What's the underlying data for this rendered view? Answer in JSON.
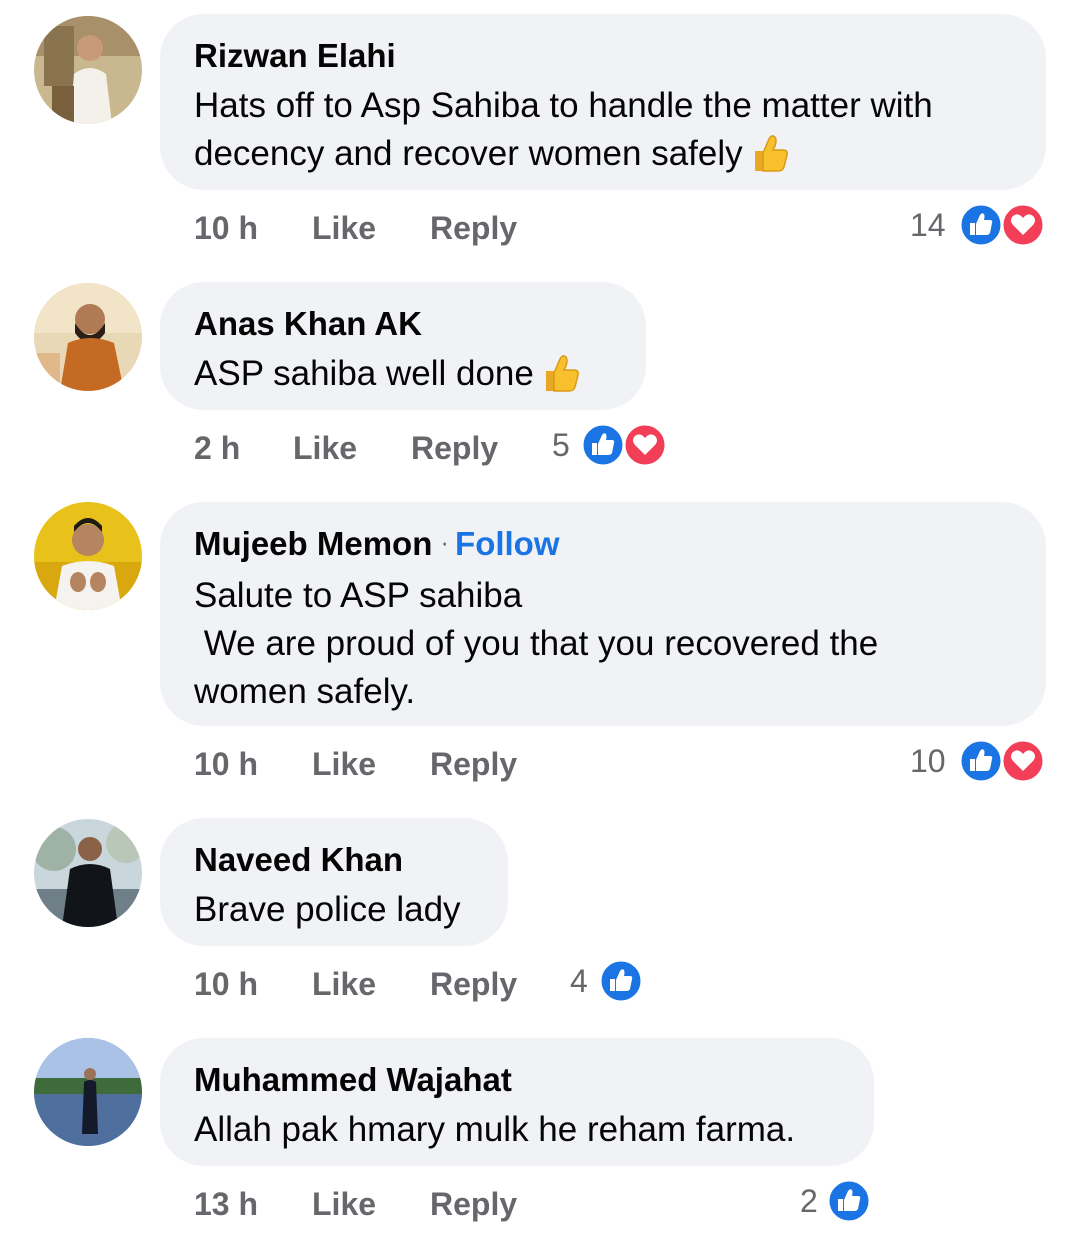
{
  "comments": [
    {
      "author": "Rizwan Elahi",
      "text": "Hats off to Asp Sahiba to handle the matter with\ndecency and recover women safely",
      "emoji": "thumbs-up-emoji",
      "time": "10 h",
      "like_label": "Like",
      "reply_label": "Reply",
      "reaction_count": "14",
      "reactions": [
        "like",
        "love"
      ]
    },
    {
      "author": "Anas Khan AK",
      "text": "ASP sahiba well done",
      "emoji": "thumbs-up-emoji",
      "time": "2 h",
      "like_label": "Like",
      "reply_label": "Reply",
      "reaction_count": "5",
      "reactions": [
        "like",
        "love"
      ]
    },
    {
      "author": "Mujeeb Memon",
      "separator": "·",
      "follow_label": "Follow",
      "text": "Salute to ASP sahiba\n We are proud of you that you recovered the\nwomen safely.",
      "time": "10 h",
      "like_label": "Like",
      "reply_label": "Reply",
      "reaction_count": "10",
      "reactions": [
        "like",
        "love"
      ]
    },
    {
      "author": "Naveed Khan",
      "text": "Brave police lady",
      "time": "10 h",
      "like_label": "Like",
      "reply_label": "Reply",
      "reaction_count": "4",
      "reactions": [
        "like"
      ]
    },
    {
      "author": "Muhammed Wajahat",
      "text": "Allah pak hmary mulk he reham farma.",
      "time": "13 h",
      "like_label": "Like",
      "reply_label": "Reply",
      "reaction_count": "2",
      "reactions": [
        "like"
      ]
    }
  ],
  "colors": {
    "bubble": "#f0f2f5",
    "meta_text": "#65676b",
    "like_blue": "#1b74e4",
    "love_red": "#f33e58",
    "follow_link": "#1b74e4"
  }
}
